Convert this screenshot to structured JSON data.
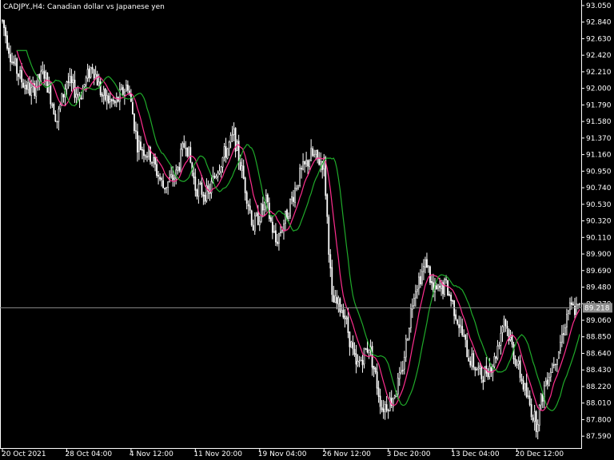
{
  "chart_data": {
    "type": "candlestick",
    "title": "CADJPY.,H4:  Canadian dollar vs Japanese yen",
    "symbol": "CADJPY.",
    "timeframe": "H4",
    "description": "Canadian dollar vs Japanese yen",
    "current_price": "89.218",
    "ylim": [
      87.45,
      93.1
    ],
    "y_ticks": [
      "93.050",
      "92.840",
      "92.630",
      "92.420",
      "92.210",
      "92.000",
      "91.790",
      "91.580",
      "91.370",
      "91.160",
      "90.950",
      "90.740",
      "90.530",
      "90.320",
      "90.110",
      "89.900",
      "89.690",
      "89.480",
      "89.270",
      "89.060",
      "88.850",
      "88.640",
      "88.430",
      "88.220",
      "88.010",
      "87.800",
      "87.590"
    ],
    "x_labels": [
      {
        "label": "20 Oct 2021",
        "bar": 0
      },
      {
        "label": "28 Oct 04:00",
        "bar": 40
      },
      {
        "label": "4 Nov 12:00",
        "bar": 80
      },
      {
        "label": "11 Nov 20:00",
        "bar": 120
      },
      {
        "label": "19 Nov 04:00",
        "bar": 160
      },
      {
        "label": "26 Nov 12:00",
        "bar": 200
      },
      {
        "label": "3 Dec 20:00",
        "bar": 240
      },
      {
        "label": "13 Dec 04:00",
        "bar": 280
      },
      {
        "label": "20 Dec 12:00",
        "bar": 320
      }
    ],
    "bars_count": 360,
    "bull_color": "#ffffff",
    "bear_color": "#ffffff",
    "bull_body": "#000000",
    "bear_body": "#ffffff",
    "grid": false,
    "anchors": [
      {
        "bar": 0,
        "p": 92.85
      },
      {
        "bar": 6,
        "p": 92.35
      },
      {
        "bar": 12,
        "p": 92.1
      },
      {
        "bar": 18,
        "p": 91.95
      },
      {
        "bar": 26,
        "p": 92.2
      },
      {
        "bar": 34,
        "p": 91.6
      },
      {
        "bar": 40,
        "p": 92.1
      },
      {
        "bar": 48,
        "p": 91.9
      },
      {
        "bar": 56,
        "p": 92.3
      },
      {
        "bar": 62,
        "p": 91.9
      },
      {
        "bar": 70,
        "p": 91.8
      },
      {
        "bar": 78,
        "p": 92.05
      },
      {
        "bar": 84,
        "p": 91.3
      },
      {
        "bar": 92,
        "p": 91.15
      },
      {
        "bar": 100,
        "p": 90.75
      },
      {
        "bar": 108,
        "p": 90.9
      },
      {
        "bar": 114,
        "p": 91.35
      },
      {
        "bar": 120,
        "p": 90.75
      },
      {
        "bar": 128,
        "p": 90.65
      },
      {
        "bar": 134,
        "p": 91.0
      },
      {
        "bar": 144,
        "p": 91.4
      },
      {
        "bar": 150,
        "p": 90.85
      },
      {
        "bar": 156,
        "p": 90.25
      },
      {
        "bar": 164,
        "p": 90.55
      },
      {
        "bar": 170,
        "p": 90.05
      },
      {
        "bar": 176,
        "p": 90.35
      },
      {
        "bar": 184,
        "p": 90.85
      },
      {
        "bar": 192,
        "p": 91.15
      },
      {
        "bar": 200,
        "p": 91.05
      },
      {
        "bar": 205,
        "p": 89.3
      },
      {
        "bar": 212,
        "p": 89.2
      },
      {
        "bar": 220,
        "p": 88.45
      },
      {
        "bar": 228,
        "p": 88.75
      },
      {
        "bar": 236,
        "p": 87.95
      },
      {
        "bar": 242,
        "p": 88.05
      },
      {
        "bar": 248,
        "p": 88.35
      },
      {
        "bar": 256,
        "p": 89.45
      },
      {
        "bar": 264,
        "p": 89.8
      },
      {
        "bar": 268,
        "p": 89.4
      },
      {
        "bar": 276,
        "p": 89.5
      },
      {
        "bar": 282,
        "p": 89.15
      },
      {
        "bar": 290,
        "p": 88.6
      },
      {
        "bar": 298,
        "p": 88.35
      },
      {
        "bar": 306,
        "p": 88.55
      },
      {
        "bar": 312,
        "p": 89.1
      },
      {
        "bar": 318,
        "p": 88.65
      },
      {
        "bar": 326,
        "p": 88.1
      },
      {
        "bar": 332,
        "p": 87.75
      },
      {
        "bar": 338,
        "p": 88.3
      },
      {
        "bar": 346,
        "p": 88.7
      },
      {
        "bar": 352,
        "p": 89.2
      },
      {
        "bar": 359,
        "p": 89.2
      }
    ],
    "series": [
      {
        "type": "ma",
        "color": "#ff2d8f",
        "period": 10
      },
      {
        "type": "ma",
        "color": "#1faa2a",
        "period": 10,
        "shift": 6
      }
    ]
  }
}
